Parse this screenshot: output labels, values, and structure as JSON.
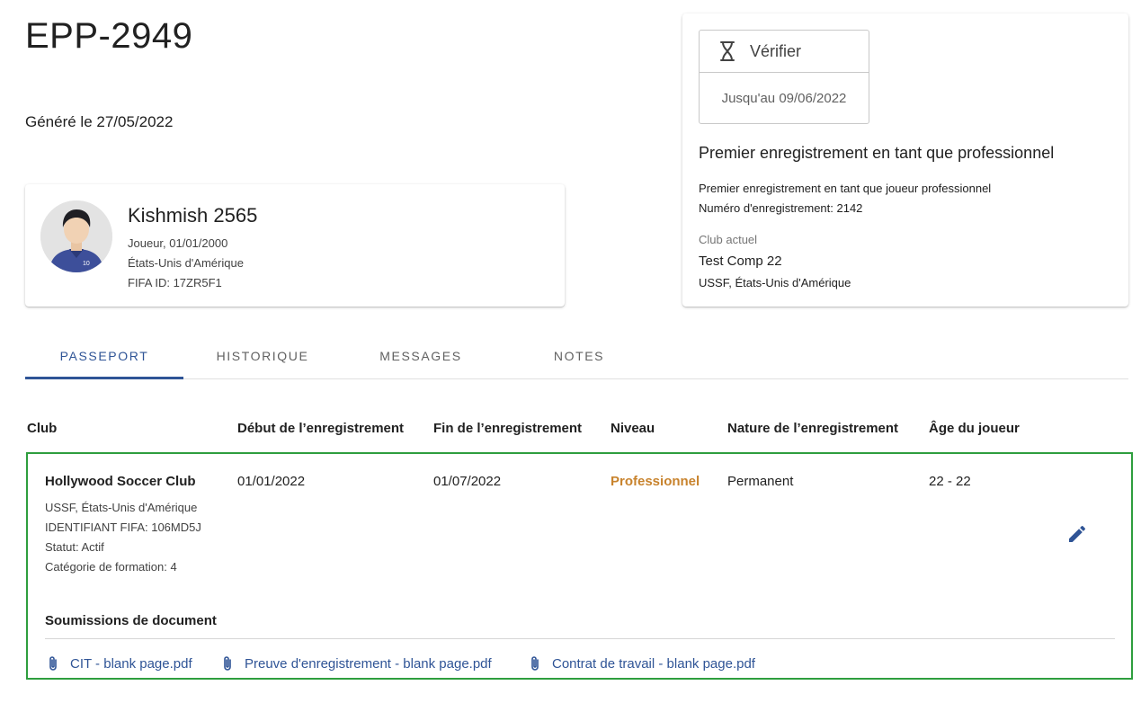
{
  "header": {
    "title": "EPP-2949",
    "generated": "Généré le 27/05/2022"
  },
  "player": {
    "name": "Kishmish 2565",
    "role_birth": "Joueur, 01/01/2000",
    "country": "États-Unis d'Amérique",
    "fifa_id": "FIFA ID: 17ZR5F1",
    "jersey_number": "10"
  },
  "verification": {
    "icon": "hourglass-icon",
    "label": "Vérifier",
    "until": "Jusqu'au 09/06/2022"
  },
  "registration": {
    "title": "Premier enregistrement en tant que professionnel",
    "description": "Premier enregistrement en tant que joueur professionnel",
    "number": "Numéro d'enregistrement: 2142",
    "club_label": "Club actuel",
    "club_name": "Test Comp 22",
    "club_association": "USSF, États-Unis d'Amérique"
  },
  "tabs": [
    {
      "label": "PASSEPORT",
      "active": true
    },
    {
      "label": "HISTORIQUE",
      "active": false
    },
    {
      "label": "MESSAGES",
      "active": false
    },
    {
      "label": "NOTES",
      "active": false
    }
  ],
  "table": {
    "headers": [
      "Club",
      "Début de l’enregistrement",
      "Fin de l’enregistrement",
      "Niveau",
      "Nature de l’enregistrement",
      "Âge du joueur"
    ],
    "row": {
      "club": "Hollywood Soccer Club",
      "club_association": "USSF, États-Unis d'Amérique",
      "club_fifa_id": "IDENTIFIANT FIFA: 106MD5J",
      "status": "Statut: Actif",
      "training_category": "Catégorie de formation: 4",
      "start": "01/01/2022",
      "end": "01/07/2022",
      "level": "Professionnel",
      "nature": "Permanent",
      "age": "22 - 22"
    },
    "documents_title": "Soumissions de document",
    "documents": [
      "CIT - blank page.pdf",
      "Preuve d'enregistrement - blank page.pdf",
      "Contrat de travail - blank page.pdf"
    ]
  },
  "colors": {
    "accent": "#2f5496",
    "level": "#c8832d",
    "row_border": "#2e9e3e"
  }
}
